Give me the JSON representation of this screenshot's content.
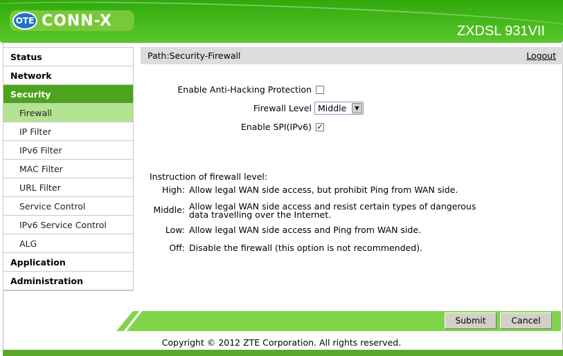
{
  "header": {
    "logo_ote": "OTE",
    "logo_text": "CONN-X",
    "model": "ZXDSL 931VII"
  },
  "sidebar": {
    "items": [
      {
        "label": "Status",
        "level": "top"
      },
      {
        "label": "Network",
        "level": "top"
      },
      {
        "label": "Security",
        "level": "top",
        "active": true
      },
      {
        "label": "Firewall",
        "level": "sub",
        "active": true
      },
      {
        "label": "IP Filter",
        "level": "sub"
      },
      {
        "label": "IPv6 Filter",
        "level": "sub"
      },
      {
        "label": "MAC Filter",
        "level": "sub"
      },
      {
        "label": "URL Filter",
        "level": "sub"
      },
      {
        "label": "Service Control",
        "level": "sub"
      },
      {
        "label": "IPv6 Service Control",
        "level": "sub"
      },
      {
        "label": "ALG",
        "level": "sub"
      },
      {
        "label": "Application",
        "level": "top"
      },
      {
        "label": "Administration",
        "level": "top"
      }
    ]
  },
  "path": {
    "text": "Path:Security-Firewall",
    "logout": "Logout"
  },
  "form": {
    "anti_hacking_label": "Enable Anti-Hacking Protection",
    "anti_hacking_checked": false,
    "level_label": "Firewall Level",
    "level_value": "Middle",
    "spi_label": "Enable SPI(IPv6)",
    "spi_checked": true
  },
  "instructions": {
    "title": "Instruction of firewall level:",
    "items": [
      {
        "key": "High:",
        "text": "Allow legal WAN side access, but prohibit Ping from WAN side."
      },
      {
        "key": "Middle:",
        "text": "Allow legal WAN side access and resist certain types of dangerous data travelling over the Internet."
      },
      {
        "key": "Low:",
        "text": "Allow legal WAN side access and Ping from WAN side."
      },
      {
        "key": "Off:",
        "text": "Disable the firewall (this option is not recommended)."
      }
    ]
  },
  "buttons": {
    "submit": "Submit",
    "cancel": "Cancel"
  },
  "footer": {
    "copyright": "Copyright © 2012 ZTE Corporation. All rights reserved."
  },
  "colors": {
    "header_green": "#3bb015",
    "nav_active": "#4ca31e",
    "sub_active": "#b4e391",
    "footbar": "#80d44a"
  }
}
